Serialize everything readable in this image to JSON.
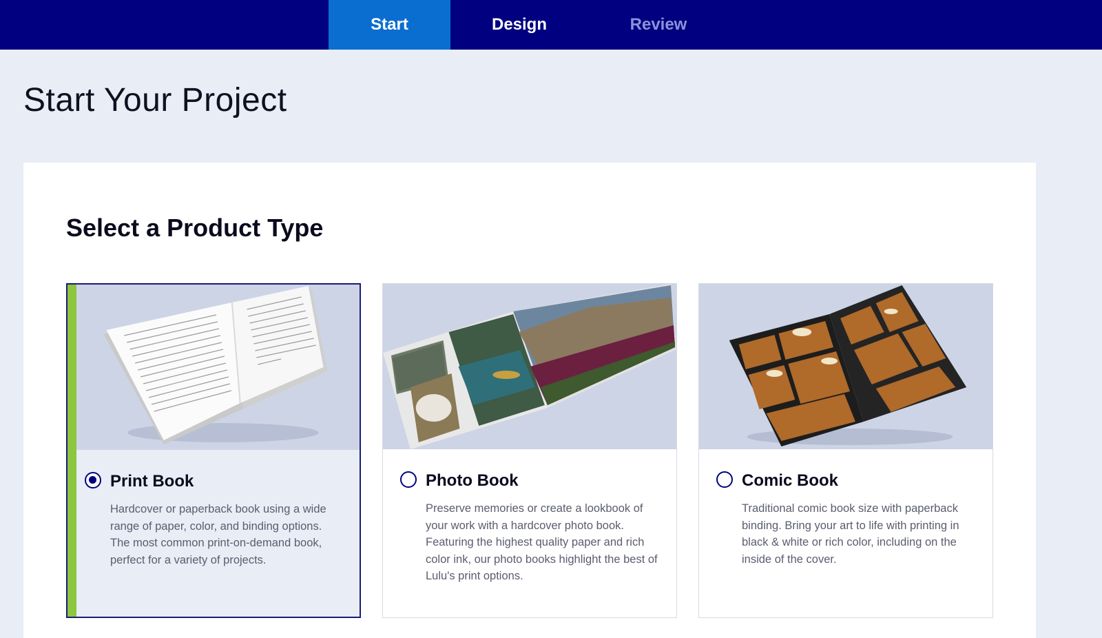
{
  "nav": {
    "tabs": [
      {
        "label": "Start",
        "state": "active"
      },
      {
        "label": "Design",
        "state": "enabled"
      },
      {
        "label": "Review",
        "state": "disabled"
      }
    ]
  },
  "page": {
    "title": "Start Your Project"
  },
  "product_section": {
    "title": "Select a Product Type",
    "products": [
      {
        "name": "Print Book",
        "selected": true,
        "image": "open-print-book-image",
        "description": "Hardcover or paperback book using a wide range of paper, color, and binding options. The most common print-on-demand book, perfect for a variety of projects."
      },
      {
        "name": "Photo Book",
        "selected": false,
        "image": "open-photo-book-image",
        "description": "Preserve memories or create a lookbook of your work with a hardcover photo book. Featuring the highest quality paper and rich color ink, our photo books highlight the best of Lulu's print options."
      },
      {
        "name": "Comic Book",
        "selected": false,
        "image": "open-comic-book-image",
        "description": "Traditional comic book size with paperback binding. Bring your art to life with printing in black & white or rich color, including on the inside of the cover."
      }
    ]
  },
  "colors": {
    "nav_background": "#000080",
    "active_tab": "#0a6ed1",
    "disabled_tab_text": "#8d91d9",
    "selected_accent": "#8dc63f",
    "radio": "#000080",
    "page_background": "#e8edf6"
  }
}
